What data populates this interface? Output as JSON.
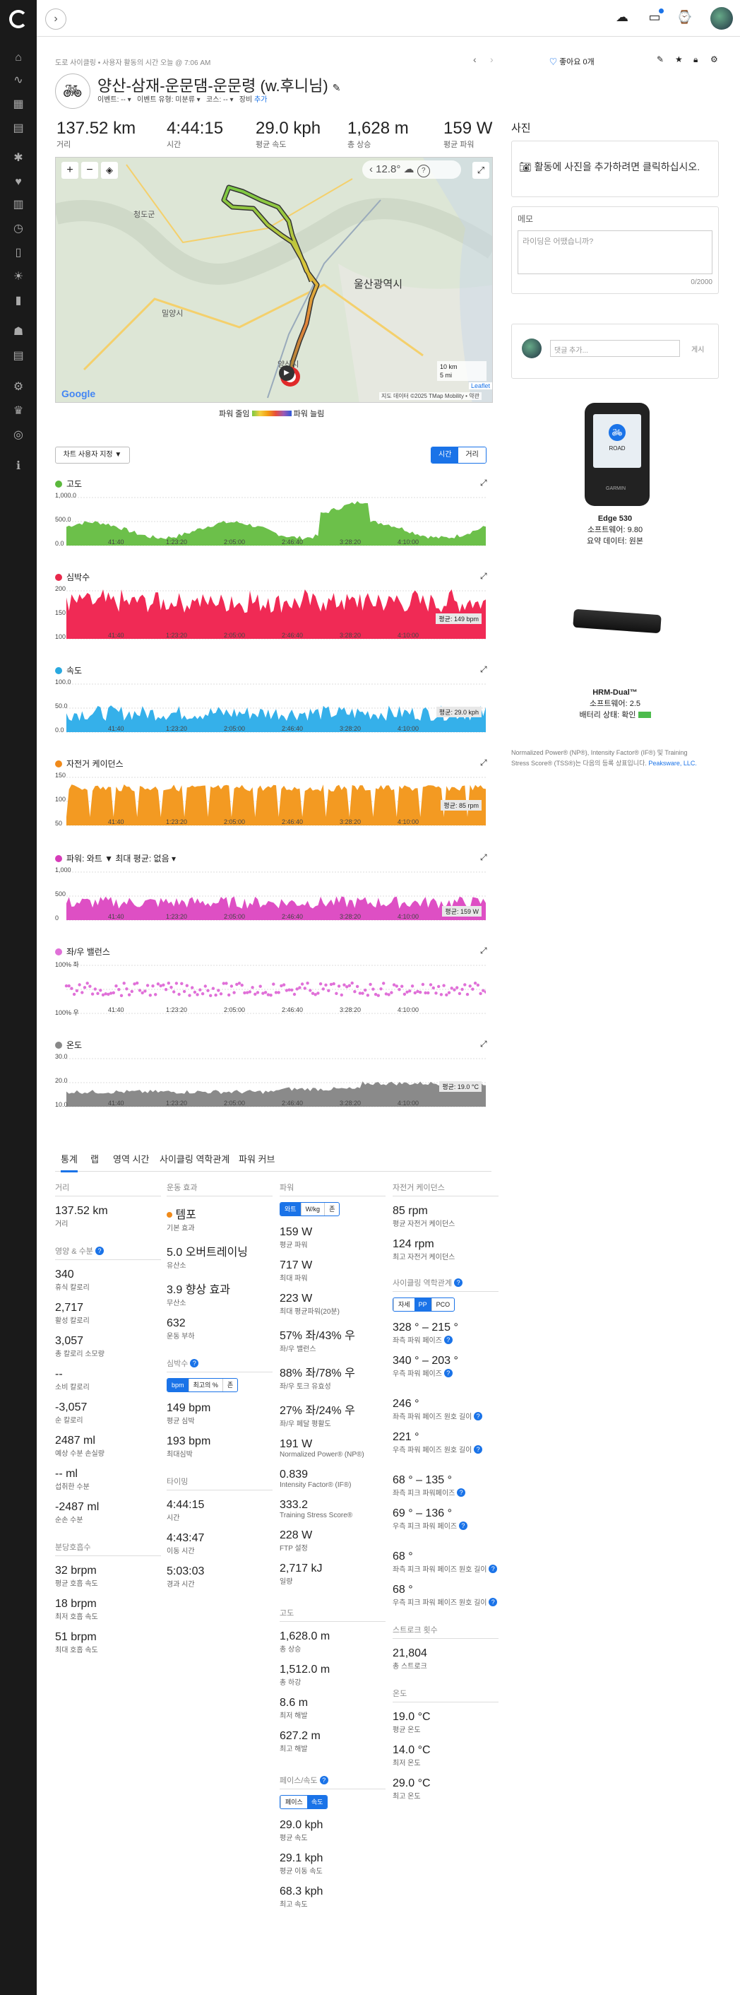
{
  "nav": {
    "back_label": "›"
  },
  "breadcrumb": {
    "text": "도로 사이클링 • 사용자 활동의 시간 오늘 @ 7:06 AM"
  },
  "header": {
    "title": "양산-삼재-운문댐-운문령 (w.후니님)",
    "like_label": "좋아요 0개",
    "meta_event": "이벤트: --",
    "meta_event_type": "이벤트 유형: 미분류",
    "meta_course": "코스: --",
    "meta_gear": "장비",
    "meta_gear_add": "추가"
  },
  "summary": [
    {
      "value": "137.52 km",
      "label": "거리"
    },
    {
      "value": "4:44:15",
      "label": "시간"
    },
    {
      "value": "29.0 kph",
      "label": "평균 속도"
    },
    {
      "value": "1,628 m",
      "label": "총 상승"
    },
    {
      "value": "159 W",
      "label": "평균 파워"
    }
  ],
  "map": {
    "temp": "12.8°",
    "city_label": "울산광역시",
    "scale_km": "10 km",
    "scale_mi": "5 mi",
    "leaflet": "Leaflet",
    "attribution": "지도 데이터 ©2025 TMap Mobility  •  약관",
    "legend_low": "파워 줄임",
    "legend_high": "파워 늘림",
    "place_1": "청도군",
    "place_2": "밀양시",
    "place_3": "양산시"
  },
  "chart_controls": {
    "settings": "차트 사용자 지정 ▼",
    "time": "시간",
    "distance": "거리"
  },
  "charts": [
    {
      "key": "elev",
      "title": "고도",
      "color": "#5bb83c",
      "fill": "#6cc04a",
      "y_ticks": [
        "1,000.0",
        "500.0",
        "0.0"
      ],
      "avg_label": ""
    },
    {
      "key": "hr",
      "title": "심박수",
      "color": "#e8284b",
      "fill": "#f02a55",
      "y_ticks": [
        "200",
        "150",
        "100"
      ],
      "avg_label": "평균: 149 bpm"
    },
    {
      "key": "speed",
      "title": "속도",
      "color": "#29a9e0",
      "fill": "#35b0ea",
      "y_ticks": [
        "100.0",
        "50.0",
        "0.0"
      ],
      "avg_label": "평균: 29.0 kph"
    },
    {
      "key": "cad",
      "title": "자전거 케이던스",
      "color": "#f08a1a",
      "fill": "#f39a22",
      "y_ticks": [
        "150",
        "100",
        "50"
      ],
      "avg_label": "평균: 85 rpm"
    },
    {
      "key": "pwr",
      "title": "파워: 와트 ▼      최대 평균: 없음 ▾",
      "color": "#d63bb8",
      "fill": "#de4fc4",
      "y_ticks": [
        "1,000",
        "500",
        "0"
      ],
      "avg_label": "평균: 159 W"
    },
    {
      "key": "bal",
      "title": "좌/우 밸런스",
      "color": "#e070d8",
      "fill": "#e070d8",
      "y_ticks": [
        "100% 좌",
        "",
        "100% 우"
      ],
      "avg_label": ""
    },
    {
      "key": "temp",
      "title": "온도",
      "color": "#888888",
      "fill": "#8a8a8a",
      "y_ticks": [
        "30.0",
        "20.0",
        "10.0"
      ],
      "avg_label": "평균: 19.0 °C"
    }
  ],
  "x_ticks": [
    "41:40",
    "1:23:20",
    "2:05:00",
    "2:46:40",
    "3:28:20",
    "4:10:00"
  ],
  "tabs": [
    "통계",
    "랩",
    "영역 시간",
    "사이클링 역학관계",
    "파워 커브"
  ],
  "stats": {
    "col1": {
      "distance_header": "거리",
      "distance": {
        "v": "137.52 km",
        "l": "거리"
      },
      "nutrition_header": "영양 & 수분",
      "items": [
        {
          "v": "340",
          "l": "휴식 칼로리"
        },
        {
          "v": "2,717",
          "l": "활성 칼로리"
        },
        {
          "v": "3,057",
          "l": "총 칼로리 소모량"
        },
        {
          "v": "--",
          "l": "소비 칼로리"
        },
        {
          "v": "-3,057",
          "l": "순 칼로리"
        },
        {
          "v": "2487 ml",
          "l": "예상 수분 손실량"
        },
        {
          "v": "-- ml",
          "l": "섭취한 수분"
        },
        {
          "v": "-2487 ml",
          "l": "순손 수분"
        }
      ],
      "resp_header": "분당호흡수",
      "resp": [
        {
          "v": "32 brpm",
          "l": "평균 호흡 속도"
        },
        {
          "v": "18 brpm",
          "l": "최저 호흡 속도"
        },
        {
          "v": "51 brpm",
          "l": "최대 호흡 속도"
        }
      ]
    },
    "col2": {
      "effect_header": "운동 효과",
      "items": [
        {
          "v": "템포",
          "l": "기본 효과"
        },
        {
          "v": "5.0 오버트레이닝",
          "l": "유산소"
        },
        {
          "v": "3.9 향상 효과",
          "l": "무산소"
        },
        {
          "v": "632",
          "l": "운동 부하"
        }
      ],
      "hr_header": "심박수",
      "hr_toggle": [
        "bpm",
        "최고의 %",
        "존"
      ],
      "hr": [
        {
          "v": "149 bpm",
          "l": "평균 심박"
        },
        {
          "v": "193 bpm",
          "l": "최대심박"
        }
      ],
      "timing_header": "타이밍",
      "timing": [
        {
          "v": "4:44:15",
          "l": "시간"
        },
        {
          "v": "4:43:47",
          "l": "이동 시간"
        },
        {
          "v": "5:03:03",
          "l": "경과 시간"
        }
      ]
    },
    "col3": {
      "power_header": "파워",
      "power_toggle": [
        "와트",
        "W/kg",
        "존"
      ],
      "items": [
        {
          "v": "159 W",
          "l": "평균 파워"
        },
        {
          "v": "717 W",
          "l": "최대 파워"
        },
        {
          "v": "223 W",
          "l": "최대 평균파워(20분)"
        },
        {
          "v": "57% 좌/43% 우",
          "l": "좌/우 밸런스"
        },
        {
          "v": "88% 좌/78% 우",
          "l": "좌/우 토크 유효성"
        },
        {
          "v": "27% 좌/24% 우",
          "l": "좌/우 페달 평활도"
        },
        {
          "v": "191 W",
          "l": "Normalized Power® (NP®)"
        },
        {
          "v": "0.839",
          "l": "Intensity Factor® (IF®)"
        },
        {
          "v": "333.2",
          "l": "Training Stress Score®"
        },
        {
          "v": "228 W",
          "l": "FTP 설정"
        },
        {
          "v": "2,717 kJ",
          "l": "일량"
        }
      ],
      "elev_header": "고도",
      "elev": [
        {
          "v": "1,628.0 m",
          "l": "총 상승"
        },
        {
          "v": "1,512.0 m",
          "l": "총 하강"
        },
        {
          "v": "8.6 m",
          "l": "최저 해발"
        },
        {
          "v": "627.2 m",
          "l": "최고 해발"
        }
      ],
      "pace_header": "페이스/속도",
      "pace_toggle": [
        "페이스",
        "속도"
      ],
      "pace": [
        {
          "v": "29.0 kph",
          "l": "평균 속도"
        },
        {
          "v": "29.1 kph",
          "l": "평균 이동 속도"
        },
        {
          "v": "68.3 kph",
          "l": "최고 속도"
        }
      ]
    },
    "col4": {
      "cad_header": "자전거 케이던스",
      "cad": [
        {
          "v": "85 rpm",
          "l": "평균 자전거 케이던스"
        },
        {
          "v": "124 rpm",
          "l": "최고 자전거 케이던스"
        }
      ],
      "dyn_header": "사이클링 역학관계",
      "dyn_toggle": [
        "자세",
        "PP",
        "PCO"
      ],
      "dyn": [
        {
          "v": "328 ° – 215 °",
          "l": "좌측 파워 페이즈"
        },
        {
          "v": "340 ° – 203 °",
          "l": "우측 파워 페이즈"
        },
        {
          "v": "246 °",
          "l": "좌측 파워 페이즈 원호 길이"
        },
        {
          "v": "221 °",
          "l": "우측 파워 페이즈 원호 길이"
        },
        {
          "v": "68 ° – 135 °",
          "l": "좌측 피크 파워페이즈"
        },
        {
          "v": "69 ° – 136 °",
          "l": "우측 피크 파워 페이즈"
        },
        {
          "v": "68 °",
          "l": "좌측 피크 파워 페이즈 원호 길이"
        },
        {
          "v": "68 °",
          "l": "우측 피크 파워 페이즈 원호 길이"
        }
      ],
      "stroke_header": "스트로크 횟수",
      "stroke": {
        "v": "21,804",
        "l": "총 스트로크"
      },
      "temp_header": "온도",
      "temp": [
        {
          "v": "19.0 °C",
          "l": "평균 온도"
        },
        {
          "v": "14.0 °C",
          "l": "최저 온도"
        },
        {
          "v": "29.0 °C",
          "l": "최고 온도"
        }
      ]
    }
  },
  "right": {
    "photo_header": "사진",
    "photo_text": "활동에 사진을 추가하려면 클릭하십시오.",
    "memo_header": "메모",
    "memo_placeholder": "라이딩은 어땠습니까?",
    "memo_count": "0/2000",
    "comment_placeholder": "댓글 추가...",
    "comment_post": "게시",
    "device1": {
      "name": "Edge 530",
      "fw": "소프트웨어: 9.80",
      "data": "요약 데이터: 원본",
      "screen": "ROAD"
    },
    "device2": {
      "name": "HRM-Dual™",
      "fw": "소프트웨어: 2.5",
      "battery": "배터리 상태: 확인"
    },
    "footnote": "Normalized Power® (NP®), Intensity Factor® (IF®) 및 Training Stress Score® (TSS®)는 다음의 등록 상표입니다.",
    "peaksware": "Peaksware, LLC."
  },
  "colors": {
    "accent": "#1a73e8",
    "sidebar": "#1a1a1a"
  }
}
